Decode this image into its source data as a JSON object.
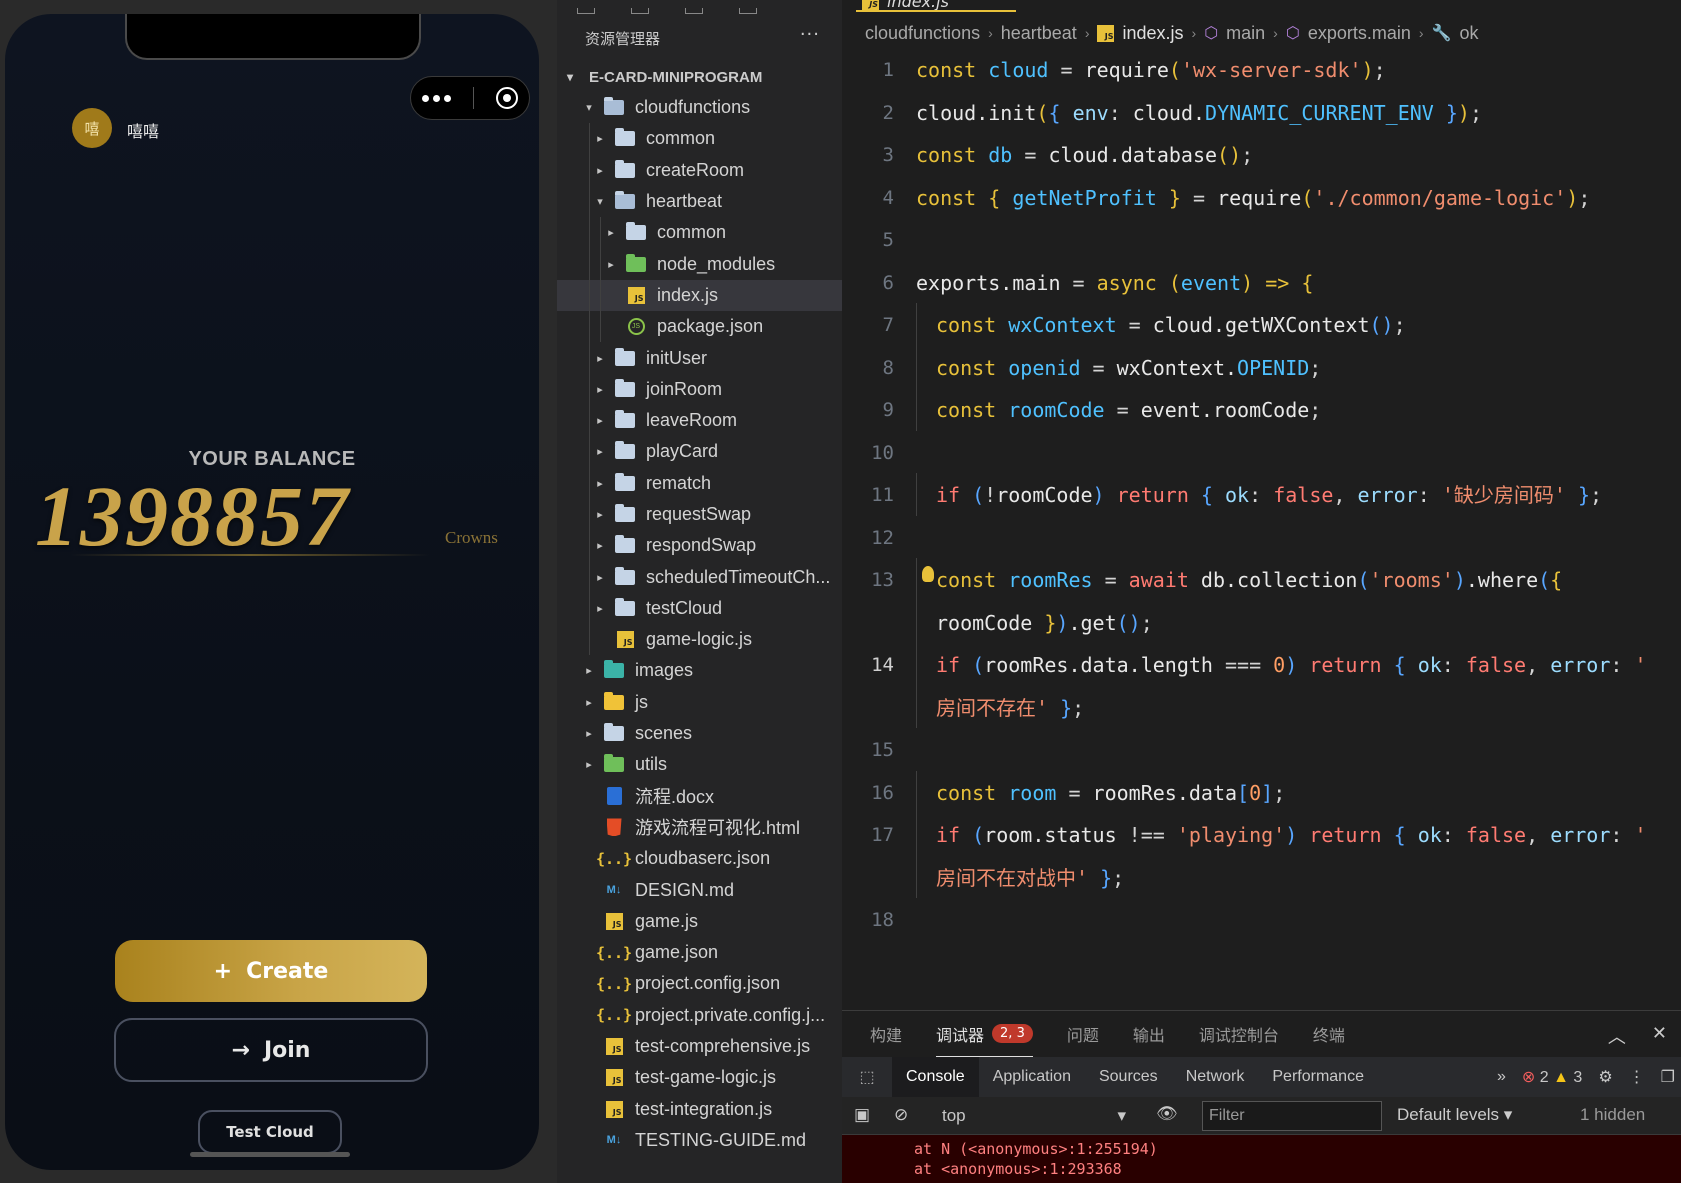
{
  "simulator": {
    "avatar_text": "嘻",
    "username": "嘻嘻",
    "balance_label": "YOUR BALANCE",
    "balance_value": "1398857",
    "balance_unit": "Crowns",
    "create_label": "Create",
    "create_icon": "+",
    "join_label": "Join",
    "join_icon": "→",
    "test_cloud_label": "Test Cloud",
    "accent_color": "#c9a34a"
  },
  "explorer": {
    "header": "资源管理器",
    "more": "···",
    "project": "E-CARD-MINIPROGRAM",
    "items": [
      {
        "label": "cloudfunctions",
        "icon": "folder-open",
        "depth": 0,
        "arrow": "▾"
      },
      {
        "label": "common",
        "icon": "folder",
        "depth": 1,
        "arrow": "▸"
      },
      {
        "label": "createRoom",
        "icon": "folder",
        "depth": 1,
        "arrow": "▸"
      },
      {
        "label": "heartbeat",
        "icon": "folder-open",
        "depth": 1,
        "arrow": "▾"
      },
      {
        "label": "common",
        "icon": "folder",
        "depth": 2,
        "arrow": "▸"
      },
      {
        "label": "node_modules",
        "icon": "folder-green",
        "depth": 2,
        "arrow": "▸"
      },
      {
        "label": "index.js",
        "icon": "js",
        "depth": 2,
        "arrow": "",
        "selected": true
      },
      {
        "label": "package.json",
        "icon": "pkg",
        "depth": 2,
        "arrow": ""
      },
      {
        "label": "initUser",
        "icon": "folder",
        "depth": 1,
        "arrow": "▸"
      },
      {
        "label": "joinRoom",
        "icon": "folder",
        "depth": 1,
        "arrow": "▸"
      },
      {
        "label": "leaveRoom",
        "icon": "folder",
        "depth": 1,
        "arrow": "▸"
      },
      {
        "label": "playCard",
        "icon": "folder",
        "depth": 1,
        "arrow": "▸"
      },
      {
        "label": "rematch",
        "icon": "folder",
        "depth": 1,
        "arrow": "▸"
      },
      {
        "label": "requestSwap",
        "icon": "folder",
        "depth": 1,
        "arrow": "▸"
      },
      {
        "label": "respondSwap",
        "icon": "folder",
        "depth": 1,
        "arrow": "▸"
      },
      {
        "label": "scheduledTimeoutCh...",
        "icon": "folder",
        "depth": 1,
        "arrow": "▸"
      },
      {
        "label": "testCloud",
        "icon": "folder",
        "depth": 1,
        "arrow": "▸"
      },
      {
        "label": "game-logic.js",
        "icon": "js",
        "depth": 1,
        "arrow": ""
      },
      {
        "label": "images",
        "icon": "folder-teal",
        "depth": 0,
        "arrow": "▸"
      },
      {
        "label": "js",
        "icon": "folder-yellow",
        "depth": 0,
        "arrow": "▸"
      },
      {
        "label": "scenes",
        "icon": "folder",
        "depth": 0,
        "arrow": "▸"
      },
      {
        "label": "utils",
        "icon": "folder-green",
        "depth": 0,
        "arrow": "▸"
      },
      {
        "label": "流程.docx",
        "icon": "doc",
        "depth": 0,
        "arrow": ""
      },
      {
        "label": "游戏流程可视化.html",
        "icon": "html",
        "depth": 0,
        "arrow": ""
      },
      {
        "label": "cloudbaserc.json",
        "icon": "json",
        "depth": 0,
        "arrow": ""
      },
      {
        "label": "DESIGN.md",
        "icon": "md",
        "depth": 0,
        "arrow": ""
      },
      {
        "label": "game.js",
        "icon": "js",
        "depth": 0,
        "arrow": ""
      },
      {
        "label": "game.json",
        "icon": "json",
        "depth": 0,
        "arrow": ""
      },
      {
        "label": "project.config.json",
        "icon": "json",
        "depth": 0,
        "arrow": ""
      },
      {
        "label": "project.private.config.j...",
        "icon": "json",
        "depth": 0,
        "arrow": ""
      },
      {
        "label": "test-comprehensive.js",
        "icon": "js",
        "depth": 0,
        "arrow": ""
      },
      {
        "label": "test-game-logic.js",
        "icon": "js",
        "depth": 0,
        "arrow": ""
      },
      {
        "label": "test-integration.js",
        "icon": "js",
        "depth": 0,
        "arrow": ""
      },
      {
        "label": "TESTING-GUIDE.md",
        "icon": "md",
        "depth": 0,
        "arrow": ""
      }
    ]
  },
  "editor": {
    "tab_label": "index.js",
    "breadcrumb": [
      "cloudfunctions",
      "heartbeat",
      "index.js",
      "main",
      "exports.main",
      "ok"
    ],
    "lines": [
      {
        "n": "1",
        "tokens": [
          [
            "kw",
            "const "
          ],
          [
            "var",
            "cloud"
          ],
          [
            "op",
            " = "
          ],
          [
            "fn",
            "require"
          ],
          [
            "br1",
            "("
          ],
          [
            "str",
            "'wx-server-sdk'"
          ],
          [
            "br1",
            ")"
          ],
          [
            "op",
            ";"
          ]
        ]
      },
      {
        "n": "2",
        "tokens": [
          [
            "fn",
            "cloud.init"
          ],
          [
            "br1",
            "("
          ],
          [
            "br2",
            "{ "
          ],
          [
            "prop",
            "env"
          ],
          [
            "op",
            ": "
          ],
          [
            "fn",
            "cloud."
          ],
          [
            "var",
            "DYNAMIC_CURRENT_ENV"
          ],
          [
            "br2",
            " }"
          ],
          [
            "br1",
            ")"
          ],
          [
            "op",
            ";"
          ]
        ]
      },
      {
        "n": "3",
        "tokens": [
          [
            "kw",
            "const "
          ],
          [
            "var",
            "db"
          ],
          [
            "op",
            " = "
          ],
          [
            "fn",
            "cloud.database"
          ],
          [
            "br1",
            "()"
          ],
          [
            "op",
            ";"
          ]
        ]
      },
      {
        "n": "4",
        "tokens": [
          [
            "kw",
            "const "
          ],
          [
            "br1",
            "{ "
          ],
          [
            "var",
            "getNetProfit"
          ],
          [
            "br1",
            " }"
          ],
          [
            "op",
            " = "
          ],
          [
            "fn",
            "require"
          ],
          [
            "br1",
            "("
          ],
          [
            "str",
            "'./common/game-logic'"
          ],
          [
            "br1",
            ")"
          ],
          [
            "op",
            ";"
          ]
        ]
      },
      {
        "n": "5",
        "tokens": []
      },
      {
        "n": "6",
        "tokens": [
          [
            "fn",
            "exports.main"
          ],
          [
            "op",
            " = "
          ],
          [
            "kw",
            "async "
          ],
          [
            "br1",
            "("
          ],
          [
            "var",
            "event"
          ],
          [
            "br1",
            ")"
          ],
          [
            "kw",
            " => "
          ],
          [
            "br1",
            "{"
          ]
        ]
      },
      {
        "n": "7",
        "indent": true,
        "tokens": [
          [
            "kw",
            "const "
          ],
          [
            "var",
            "wxContext"
          ],
          [
            "op",
            " = "
          ],
          [
            "fn",
            "cloud.getWXContext"
          ],
          [
            "br2",
            "()"
          ],
          [
            "op",
            ";"
          ]
        ]
      },
      {
        "n": "8",
        "indent": true,
        "tokens": [
          [
            "kw",
            "const "
          ],
          [
            "var",
            "openid"
          ],
          [
            "op",
            " = "
          ],
          [
            "fn",
            "wxContext."
          ],
          [
            "var",
            "OPENID"
          ],
          [
            "op",
            ";"
          ]
        ]
      },
      {
        "n": "9",
        "indent": true,
        "tokens": [
          [
            "kw",
            "const "
          ],
          [
            "var",
            "roomCode"
          ],
          [
            "op",
            " = "
          ],
          [
            "fn",
            "event.roomCode"
          ],
          [
            "op",
            ";"
          ]
        ]
      },
      {
        "n": "10",
        "tokens": []
      },
      {
        "n": "11",
        "indent": true,
        "tokens": [
          [
            "kw2",
            "if "
          ],
          [
            "br2",
            "("
          ],
          [
            "op",
            "!"
          ],
          [
            "fn",
            "roomCode"
          ],
          [
            "br2",
            ")"
          ],
          [
            "kw2",
            " return "
          ],
          [
            "br2",
            "{ "
          ],
          [
            "prop",
            "ok"
          ],
          [
            "op",
            ": "
          ],
          [
            "kw2",
            "false"
          ],
          [
            "op",
            ", "
          ],
          [
            "prop",
            "error"
          ],
          [
            "op",
            ": "
          ],
          [
            "str",
            "'缺少房间码'"
          ],
          [
            "br2",
            " }"
          ],
          [
            "op",
            ";"
          ]
        ]
      },
      {
        "n": "12",
        "tokens": []
      },
      {
        "n": "13",
        "indent": true,
        "bulb": true,
        "tokens": [
          [
            "kw",
            "const "
          ],
          [
            "var",
            "roomRes"
          ],
          [
            "op",
            " = "
          ],
          [
            "kw2",
            "await "
          ],
          [
            "fn",
            "db.collection"
          ],
          [
            "br2",
            "("
          ],
          [
            "str",
            "'rooms'"
          ],
          [
            "br2",
            ")"
          ],
          [
            "fn",
            ".where"
          ],
          [
            "br2",
            "("
          ],
          [
            "br1",
            "{"
          ]
        ]
      },
      {
        "n": "",
        "indent": true,
        "tokens": [
          [
            "fn",
            "roomCode "
          ],
          [
            "br1",
            "}"
          ],
          [
            "br2",
            ")"
          ],
          [
            "fn",
            ".get"
          ],
          [
            "br2",
            "()"
          ],
          [
            "op",
            ";"
          ]
        ]
      },
      {
        "n": "14",
        "active": true,
        "indent": true,
        "tokens": [
          [
            "kw2",
            "if "
          ],
          [
            "br2",
            "("
          ],
          [
            "fn",
            "roomRes.data.length"
          ],
          [
            "op",
            " === "
          ],
          [
            "num",
            "0"
          ],
          [
            "br2",
            ")"
          ],
          [
            "kw2",
            " return "
          ],
          [
            "br2",
            "{ "
          ],
          [
            "prop",
            "ok"
          ],
          [
            "op",
            ": "
          ],
          [
            "kw2",
            "false"
          ],
          [
            "op",
            ", "
          ],
          [
            "prop",
            "error"
          ],
          [
            "op",
            ": "
          ],
          [
            "str",
            "'"
          ]
        ]
      },
      {
        "n": "",
        "indent": true,
        "tokens": [
          [
            "str",
            "房间不存在'"
          ],
          [
            "br2",
            " }"
          ],
          [
            "op",
            ";"
          ]
        ]
      },
      {
        "n": "15",
        "tokens": []
      },
      {
        "n": "16",
        "indent": true,
        "tokens": [
          [
            "kw",
            "const "
          ],
          [
            "var",
            "room"
          ],
          [
            "op",
            " = "
          ],
          [
            "fn",
            "roomRes.data"
          ],
          [
            "br2",
            "["
          ],
          [
            "num",
            "0"
          ],
          [
            "br2",
            "]"
          ],
          [
            "op",
            ";"
          ]
        ]
      },
      {
        "n": "17",
        "indent": true,
        "tokens": [
          [
            "kw2",
            "if "
          ],
          [
            "br2",
            "("
          ],
          [
            "fn",
            "room.status"
          ],
          [
            "op",
            " !== "
          ],
          [
            "str",
            "'playing'"
          ],
          [
            "br2",
            ")"
          ],
          [
            "kw2",
            " return "
          ],
          [
            "br2",
            "{ "
          ],
          [
            "prop",
            "ok"
          ],
          [
            "op",
            ": "
          ],
          [
            "kw2",
            "false"
          ],
          [
            "op",
            ", "
          ],
          [
            "prop",
            "error"
          ],
          [
            "op",
            ": "
          ],
          [
            "str",
            "'"
          ]
        ]
      },
      {
        "n": "",
        "indent": true,
        "tokens": [
          [
            "str",
            "房间不在对战中'"
          ],
          [
            "br2",
            " }"
          ],
          [
            "op",
            ";"
          ]
        ]
      },
      {
        "n": "18",
        "tokens": []
      }
    ]
  },
  "panel": {
    "tabs": [
      "构建",
      "调试器",
      "问题",
      "输出",
      "调试控制台",
      "终端"
    ],
    "active_tab": 1,
    "debugger_badge": "2, 3",
    "devtools_tabs": [
      "Console",
      "Application",
      "Sources",
      "Network",
      "Performance"
    ],
    "more_tabs": "»",
    "error_count": "2",
    "warning_count": "3",
    "context": "top",
    "filter_placeholder": "Filter",
    "levels": "Default levels",
    "hidden": "1 hidden",
    "console_lines": [
      "at N (<anonymous>:1:255194)",
      "at <anonymous>:1:293368"
    ]
  }
}
